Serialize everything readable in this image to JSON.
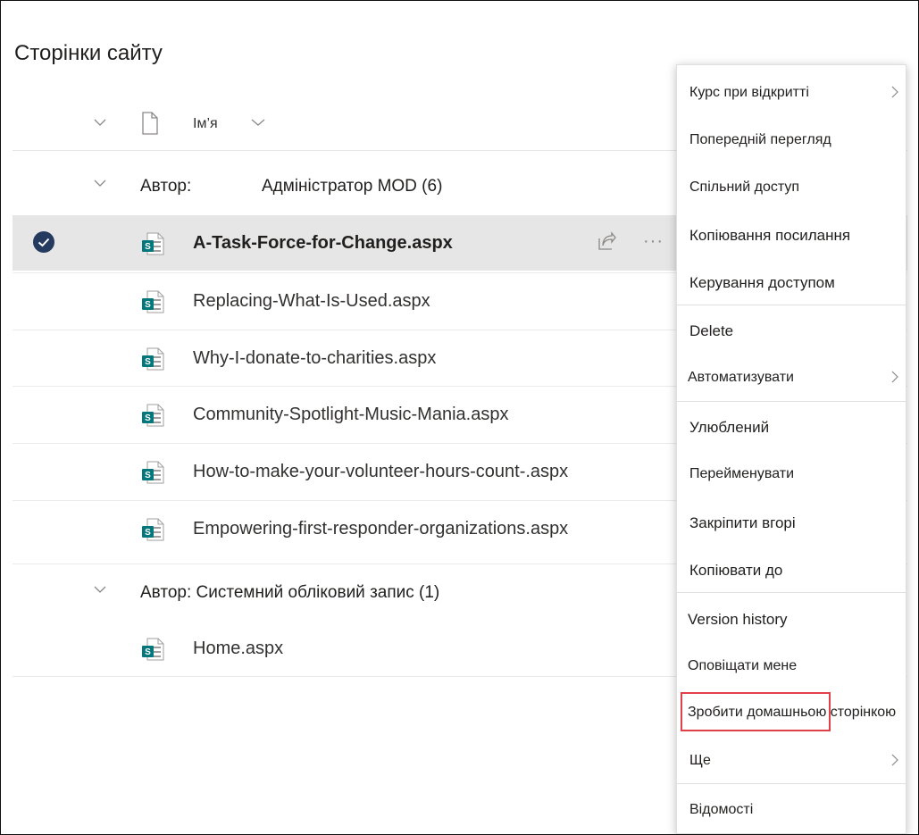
{
  "page": {
    "title": "Сторінки сайту"
  },
  "header": {
    "name_column": "Ім’я"
  },
  "groups": [
    {
      "label": "Автор:",
      "name": "Адміністратор MOD (6)"
    },
    {
      "label": "Автор: Системний обліковий запис (1)"
    }
  ],
  "files": [
    "A-Task-Force-for-Change.aspx",
    "Replacing-What-Is-Used.aspx",
    "Why-I-donate-to-charities.aspx",
    "Community-Spotlight-Music-Mania.aspx",
    "How-to-make-your-volunteer-hours-count-.aspx",
    "Empowering-first-responder-organizations.aspx",
    "Home.aspx"
  ],
  "row_actions": {
    "more": "···"
  },
  "menu": {
    "items": [
      "Курс при відкритті",
      "Попередній перегляд",
      "Спільний доступ",
      "Копіювання посилання",
      "Керування доступом",
      "Delete",
      "Автоматизувати",
      "Улюблений",
      "Перейменувати",
      "Закріпити вгорі",
      "Копіювати до",
      "Version history",
      "Оповіщати мене",
      "Зробити домашньою сторінкою",
      "Ще",
      "Відомості"
    ]
  },
  "colors": {
    "sharepoint_icon": "#03787c",
    "highlight": "#e0404a",
    "selected_row": "#e6e6e6",
    "check": "#243a5e"
  },
  "icons": [
    "chevron-down-icon",
    "file-icon",
    "sharepoint-page-icon",
    "checkmark-icon",
    "share-icon",
    "chevron-right-icon"
  ]
}
